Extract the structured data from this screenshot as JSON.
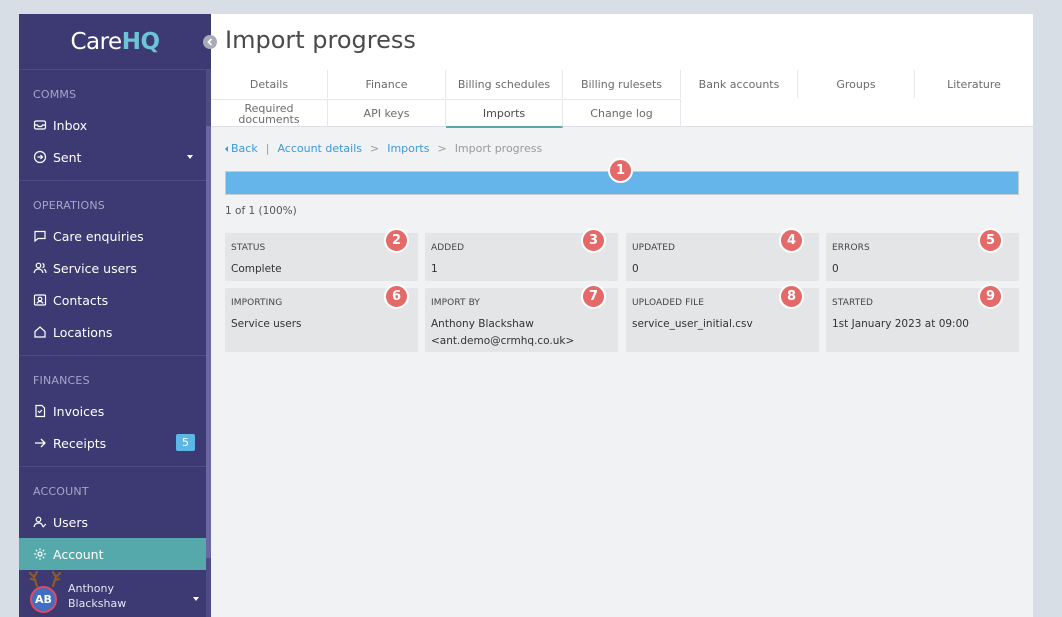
{
  "app": {
    "logo_care": "Care",
    "logo_hq": "HQ"
  },
  "sidebar": {
    "sections": [
      {
        "title": "COMMS",
        "items": [
          {
            "label": "Inbox",
            "icon": "inbox-icon"
          },
          {
            "label": "Sent",
            "icon": "sent-icon",
            "has_dropdown": true
          }
        ]
      },
      {
        "title": "OPERATIONS",
        "items": [
          {
            "label": "Care enquiries",
            "icon": "chat-icon"
          },
          {
            "label": "Service users",
            "icon": "users-icon"
          },
          {
            "label": "Contacts",
            "icon": "contact-card-icon"
          },
          {
            "label": "Locations",
            "icon": "home-icon"
          }
        ]
      },
      {
        "title": "FINANCES",
        "items": [
          {
            "label": "Invoices",
            "icon": "invoice-icon"
          },
          {
            "label": "Receipts",
            "icon": "arrow-right-icon",
            "badge": "5"
          }
        ]
      },
      {
        "title": "ACCOUNT",
        "items": [
          {
            "label": "Users",
            "icon": "user-check-icon"
          },
          {
            "label": "Account",
            "icon": "gear-icon",
            "active": true
          }
        ]
      }
    ],
    "user": {
      "initials": "AB",
      "first_name": "Anthony",
      "last_name": "Blackshaw"
    }
  },
  "page": {
    "title": "Import progress",
    "tabs_row1": [
      "Details",
      "Finance",
      "Billing schedules",
      "Billing rulesets",
      "Bank accounts",
      "Groups",
      "Literature"
    ],
    "tabs_row2": [
      {
        "line1": "Required",
        "line2": "documents"
      },
      {
        "line1": "API keys"
      },
      {
        "line1": "Imports",
        "active": true
      },
      {
        "line1": "Change log"
      }
    ],
    "breadcrumb": {
      "back": "Back",
      "separator": "|",
      "arrow": ">",
      "items": [
        "Account details",
        "Imports",
        "Import progress"
      ]
    },
    "progress": {
      "fraction": 1.0,
      "text": "1 of 1 (100%)"
    },
    "cards": [
      {
        "label": "STATUS",
        "value": "Complete"
      },
      {
        "label": "ADDED",
        "value": "1"
      },
      {
        "label": "UPDATED",
        "value": "0"
      },
      {
        "label": "ERRORS",
        "value": "0"
      },
      {
        "label": "IMPORTING",
        "value": "Service users"
      },
      {
        "label": "IMPORT BY",
        "value": "Anthony Blackshaw",
        "value2": "<ant.demo@crmhq.co.uk>"
      },
      {
        "label": "UPLOADED FILE",
        "value": "service_user_initial.csv"
      },
      {
        "label": "STARTED",
        "value": "1st January 2023 at 09:00"
      }
    ],
    "markers": [
      "1",
      "2",
      "3",
      "4",
      "5",
      "6",
      "7",
      "8",
      "9"
    ]
  },
  "colors": {
    "sidebar": "#3d3a73",
    "active": "#56a9ab",
    "accent": "#66b5ea",
    "marker": "#e46a6a"
  }
}
